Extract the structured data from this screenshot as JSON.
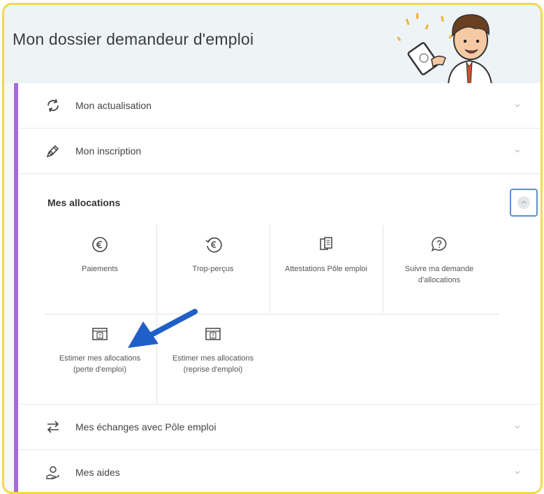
{
  "header": {
    "title": "Mon dossier demandeur d'emploi"
  },
  "rows": {
    "actualisation": {
      "label": "Mon actualisation",
      "icon": "refresh-icon"
    },
    "inscription": {
      "label": "Mon inscription",
      "icon": "pen-icon"
    },
    "echanges": {
      "label": "Mes échanges avec Pôle emploi",
      "icon": "exchange-icon"
    },
    "aides": {
      "label": "Mes aides",
      "icon": "hands-icon"
    }
  },
  "allocations": {
    "title": "Mes allocations",
    "tiles": [
      {
        "label": "Paiements",
        "icon": "euro-icon"
      },
      {
        "label": "Trop-perçus",
        "icon": "euro-return-icon"
      },
      {
        "label": "Attestations Pôle emploi",
        "icon": "documents-icon"
      },
      {
        "label": "Suivre ma demande d'allocations",
        "icon": "question-bubble-icon"
      },
      {
        "label": "Estimer mes allocations (perte d'emploi)",
        "icon": "question-folder-icon"
      },
      {
        "label": "Estimer mes allocations (reprise d'emploi)",
        "icon": "question-folder-icon"
      }
    ]
  },
  "colors": {
    "accent": "#a56bdc",
    "frame": "#f2d94e",
    "arrow": "#1f5fc8",
    "focus": "#5b8fd0"
  }
}
